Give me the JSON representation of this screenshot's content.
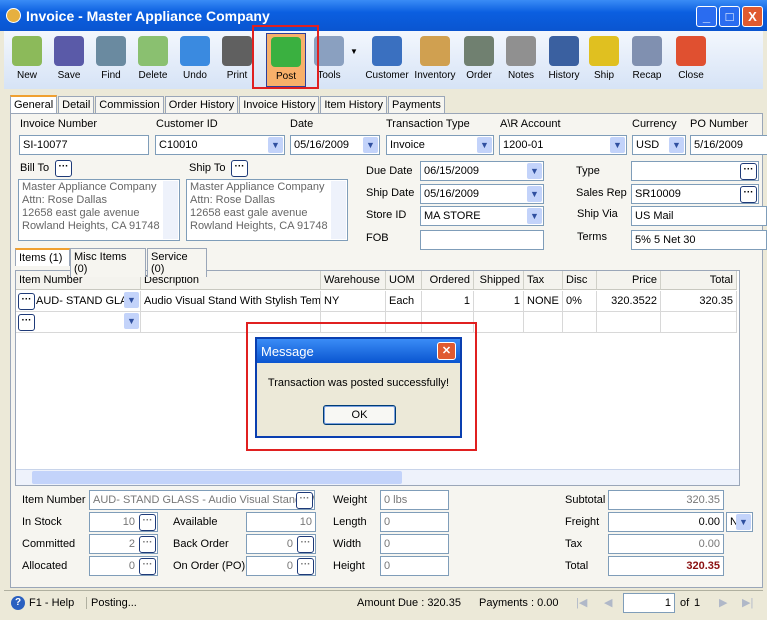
{
  "window": {
    "title": "Invoice - Master Appliance Company",
    "min": "_",
    "max": "□",
    "close": "X"
  },
  "toolbar": [
    {
      "label": "New",
      "icon": "new-icon",
      "color": "#8cba5a"
    },
    {
      "label": "Save",
      "icon": "save-icon",
      "color": "#5a5aa8"
    },
    {
      "label": "Find",
      "icon": "find-icon",
      "color": "#6a8aa0"
    },
    {
      "label": "Delete",
      "icon": "delete-icon",
      "color": "#8ac070"
    },
    {
      "label": "Undo",
      "icon": "undo-icon",
      "color": "#3a8ae0"
    },
    {
      "label": "Print",
      "icon": "print-icon",
      "color": "#606060"
    },
    {
      "label": "Post",
      "icon": "post-icon",
      "color": "#3ab040"
    },
    {
      "label": "Tools",
      "icon": "tools-icon",
      "color": "#8aa0c0"
    },
    {
      "label": "Customer",
      "icon": "customer-icon",
      "color": "#3a70c0"
    },
    {
      "label": "Inventory",
      "icon": "inventory-icon",
      "color": "#d0a050"
    },
    {
      "label": "Order",
      "icon": "order-icon",
      "color": "#708070"
    },
    {
      "label": "Notes",
      "icon": "notes-icon",
      "color": "#909090"
    },
    {
      "label": "History",
      "icon": "history-icon",
      "color": "#3a60a0"
    },
    {
      "label": "Ship",
      "icon": "ship-icon",
      "color": "#e0c020"
    },
    {
      "label": "Recap",
      "icon": "recap-icon",
      "color": "#8090b0"
    },
    {
      "label": "Close",
      "icon": "close-icon",
      "color": "#e05030"
    }
  ],
  "tabs": [
    "General",
    "Detail",
    "Commission",
    "Order History",
    "Invoice History",
    "Item History",
    "Payments"
  ],
  "header": {
    "invoice_number": {
      "label": "Invoice Number",
      "value": "SI-10077"
    },
    "customer_id": {
      "label": "Customer ID",
      "value": "C10010"
    },
    "date": {
      "label": "Date",
      "value": "05/16/2009"
    },
    "transaction_type": {
      "label": "Transaction Type",
      "value": "Invoice"
    },
    "ar_account": {
      "label": "A\\R Account",
      "value": "1200-01"
    },
    "currency": {
      "label": "Currency",
      "value": "USD"
    },
    "po_number": {
      "label": "PO Number",
      "value": "5/16/2009"
    }
  },
  "bill_to": {
    "label": "Bill To",
    "lines": [
      "Master Appliance Company",
      "Attn: Rose Dallas",
      "12658 east gale avenue",
      "Rowland Heights, CA 91748"
    ]
  },
  "ship_to": {
    "label": "Ship To",
    "lines": [
      "Master Appliance Company",
      "Attn: Rose Dallas",
      "12658 east gale avenue",
      "Rowland Heights, CA 91748"
    ]
  },
  "mid": {
    "due_date": {
      "label": "Due Date",
      "value": "06/15/2009"
    },
    "ship_date": {
      "label": "Ship Date",
      "value": "05/16/2009"
    },
    "store_id": {
      "label": "Store ID",
      "value": "MA STORE"
    },
    "fob": {
      "label": "FOB",
      "value": ""
    }
  },
  "right": {
    "type": {
      "label": "Type",
      "value": ""
    },
    "sales_rep": {
      "label": "Sales Rep",
      "value": "SR10009"
    },
    "ship_via": {
      "label": "Ship Via",
      "value": "US Mail"
    },
    "terms": {
      "label": "Terms",
      "value": "5% 5 Net 30"
    }
  },
  "item_tabs": [
    "Items (1)",
    "Misc Items (0)",
    "Service (0)"
  ],
  "grid": {
    "columns": [
      "Item Number",
      "Description",
      "Warehouse",
      "UOM",
      "Ordered",
      "Shipped",
      "Tax",
      "Disc",
      "Price",
      "Total"
    ],
    "rows": [
      [
        "AUD- STAND GLAS",
        "Audio Visual Stand With Stylish Temp",
        "NY",
        "Each",
        "1",
        "1",
        "NONE",
        "0%",
        "320.3522",
        "320.35"
      ]
    ]
  },
  "dialog": {
    "title": "Message",
    "text": "Transaction was posted successfully!",
    "ok": "OK"
  },
  "bottom": {
    "item_number": {
      "label": "Item Number",
      "value": "AUD- STAND GLASS - Audio Visual Stand W"
    },
    "in_stock": {
      "label": "In Stock",
      "value": "10"
    },
    "committed": {
      "label": "Committed",
      "value": "2"
    },
    "allocated": {
      "label": "Allocated",
      "value": "0"
    },
    "available": {
      "label": "Available",
      "value": "10"
    },
    "back_order": {
      "label": "Back Order",
      "value": "0"
    },
    "on_order": {
      "label": "On Order (PO)",
      "value": "0"
    },
    "weight": {
      "label": "Weight",
      "value": "0 lbs"
    },
    "length": {
      "label": "Length",
      "value": "0"
    },
    "width": {
      "label": "Width",
      "value": "0"
    },
    "height": {
      "label": "Height",
      "value": "0"
    },
    "subtotal": {
      "label": "Subtotal",
      "value": "320.35"
    },
    "freight": {
      "label": "Freight",
      "value": "0.00",
      "option": "N"
    },
    "tax": {
      "label": "Tax",
      "value": "0.00"
    },
    "total": {
      "label": "Total",
      "value": "320.35"
    }
  },
  "status": {
    "help": "F1 - Help",
    "message": "Posting...",
    "amount_due": "Amount Due : 320.35",
    "payments": "Payments : 0.00",
    "page": "1",
    "of": "of",
    "total_pages": "1"
  }
}
